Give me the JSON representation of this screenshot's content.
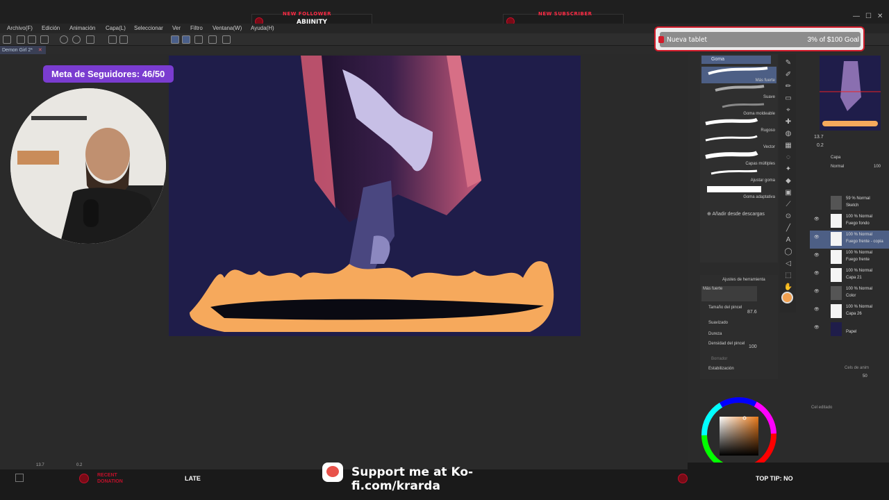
{
  "alerts": {
    "follower_tag": "NEW FOLLOWER",
    "follower_name": "ABIINITY",
    "subscriber_tag": "NEW SUBSCRIBER",
    "recent_donation_label": "RECENT DONATION",
    "late_label": "LATE",
    "top_tip_label": "TOP TIP: NO"
  },
  "goal": {
    "label": "Nueva tablet",
    "progress_text": "3% of $100 Goal",
    "progress_fraction": 0.03
  },
  "follower_goal": {
    "text": "Meta de Seguidores:  46/50",
    "current": 46,
    "target": 50
  },
  "menu": {
    "items": [
      "Archivo(F)",
      "Edición",
      "Animación",
      "Capa(L)",
      "Seleccionar",
      "Ver",
      "Filtro",
      "Ventana(W)",
      "Ayuda(H)"
    ]
  },
  "document": {
    "tab_label": "Demon Girl 2*"
  },
  "brushes": {
    "header": "Goma",
    "items": [
      "Más fuerte",
      "Suave",
      "Goma moldeable",
      "Rugoso",
      "Vector",
      "Capas múltiples",
      "Ajustar goma",
      "Goma adaptativa"
    ],
    "add_label": "Añadir desde descargas"
  },
  "tool_settings": {
    "header": "Ajustes de herramienta",
    "preset": "Más fuerte",
    "brush_size_label": "Tamaño del pincel",
    "brush_size_value": "87.6",
    "smooth_label": "Suavizado",
    "hardness_label": "Dureza",
    "density_label": "Densidad del pincel",
    "density_value": "100",
    "eraser_label": "Borrador",
    "stabilization_label": "Estabilización"
  },
  "navigator": {
    "zoom": "13.7",
    "angle": "0.2"
  },
  "layers": {
    "header": "Capa",
    "blend": "Normal",
    "opacity": "100",
    "items": [
      {
        "pct": "59 % Normal",
        "name": "Sketch"
      },
      {
        "pct": "100 % Normal",
        "name": "Fuego fondo"
      },
      {
        "pct": "100 % Normal",
        "name": "Fuego frente - copia"
      },
      {
        "pct": "100 % Normal",
        "name": "Fuego frente"
      },
      {
        "pct": "100 % Normal",
        "name": "Capa 21"
      },
      {
        "pct": "100 % Normal",
        "name": "Color"
      },
      {
        "pct": "100 % Normal",
        "name": "Capa 26"
      },
      {
        "pct": "",
        "name": "Papel"
      }
    ]
  },
  "animation_panel": {
    "header": "Cels de anim",
    "value": "50",
    "edited": "Cel editado"
  },
  "status": {
    "zoom": "13.7",
    "angle": "0.2"
  },
  "kofi": {
    "text": "Support me at Ko-fi.com/krarda"
  },
  "colors": {
    "accent": "#7a3cd0",
    "alert_red": "#d11b2a",
    "canvas_bg": "#1f1d4a",
    "fire": "#f6a95c",
    "current_color": "#f2a04f"
  }
}
